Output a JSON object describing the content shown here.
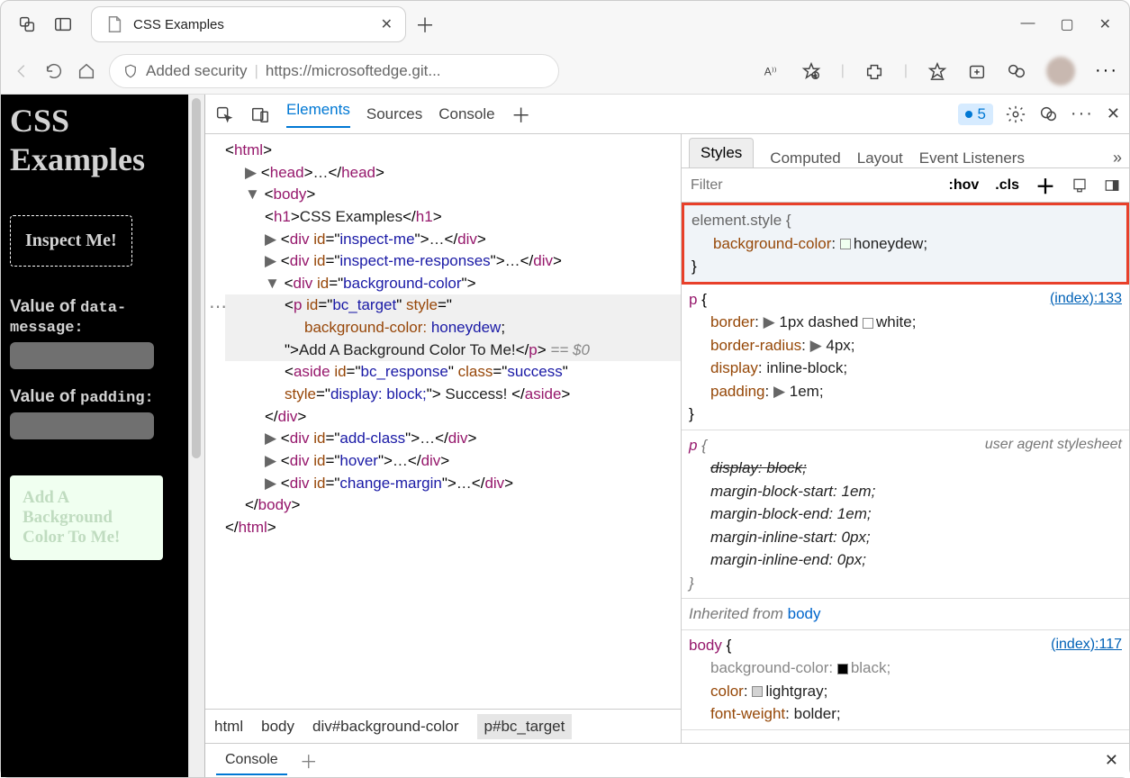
{
  "browser": {
    "tab_title": "CSS Examples",
    "security_label": "Added security",
    "url": "https://microsoftedge.git..."
  },
  "page": {
    "heading": "CSS Examples",
    "inspect_label": "Inspect Me!",
    "value1_label": "Value of ",
    "value1_code": "data-message:",
    "value2_label": "Value of ",
    "value2_code": "padding:",
    "honeydew_text": "Add A Background Color To Me!"
  },
  "devtools": {
    "tabs": {
      "elements": "Elements",
      "sources": "Sources",
      "console": "Console"
    },
    "issues_count": "5",
    "dom": {
      "h1_text": "CSS Examples",
      "inspect_me": "inspect-me",
      "inspect_me_responses": "inspect-me-responses",
      "bg_color": "background-color",
      "p_id": "bc_target",
      "p_style_prop": "background-color:",
      "p_style_val": "honeydew",
      "p_text": "Add A Background Color To Me!",
      "eq0": "== $0",
      "aside_id": "bc_response",
      "aside_class": "success",
      "aside_style": "display: block;",
      "aside_text": " Success! ",
      "add_class": "add-class",
      "hover": "hover",
      "change_margin": "change-margin"
    },
    "crumbs": [
      "html",
      "body",
      "div#background-color",
      "p#bc_target"
    ],
    "styles": {
      "tabs": [
        "Styles",
        "Computed",
        "Layout",
        "Event Listeners"
      ],
      "filter_placeholder": "Filter",
      "hov": ":hov",
      "cls": ".cls",
      "elem_style": "element.style {",
      "bg_prop": "background-color",
      "bg_val": "honeydew",
      "link1": "(index):133",
      "p_rule": {
        "border": "1px dashed",
        "border_color": "white",
        "radius": "4px",
        "display": "inline-block",
        "padding": "1em"
      },
      "ua_label": "user agent stylesheet",
      "ua_display": "block",
      "mbs": "1em",
      "mbe": "1em",
      "mis": "0px",
      "mie": "0px",
      "inherit_label": "Inherited from",
      "inherit_from": "body",
      "link2": "(index):117",
      "body_bg": "black",
      "body_color": "lightgray",
      "body_fw": "bolder"
    },
    "drawer_console": "Console"
  }
}
